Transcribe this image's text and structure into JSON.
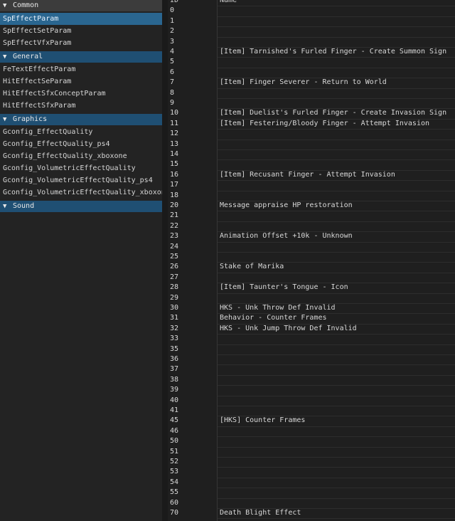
{
  "sidebar": {
    "categories": [
      {
        "label": "Common",
        "items": [
          "SpEffectParam",
          "SpEffectSetParam",
          "SpEffectVfxParam"
        ],
        "selected": 0
      },
      {
        "label": "General",
        "items": [
          "FeTextEffectParam",
          "HitEffectSeParam",
          "HitEffectSfxConceptParam",
          "HitEffectSfxParam"
        ]
      },
      {
        "label": "Graphics",
        "items": [
          "Gconfig_EffectQuality",
          "Gconfig_EffectQuality_ps4",
          "Gconfig_EffectQuality_xboxone",
          "Gconfig_VolumetricEffectQuality",
          "Gconfig_VolumetricEffectQuality_ps4",
          "Gconfig_VolumetricEffectQuality_xboxone"
        ]
      },
      {
        "label": "Sound",
        "items": []
      }
    ],
    "expand_icon": "triangle-down-icon"
  },
  "grid": {
    "header": {
      "id": "ID",
      "name": "Name"
    },
    "rows": [
      {
        "id": "0",
        "name": ""
      },
      {
        "id": "1",
        "name": ""
      },
      {
        "id": "2",
        "name": ""
      },
      {
        "id": "3",
        "name": ""
      },
      {
        "id": "4",
        "name": "[Item] Tarnished's Furled Finger - Create Summon Sign"
      },
      {
        "id": "5",
        "name": ""
      },
      {
        "id": "6",
        "name": ""
      },
      {
        "id": "7",
        "name": "[Item] Finger Severer - Return to World"
      },
      {
        "id": "8",
        "name": ""
      },
      {
        "id": "9",
        "name": ""
      },
      {
        "id": "10",
        "name": "[Item] Duelist's Furled Finger - Create Invasion Sign"
      },
      {
        "id": "11",
        "name": "[Item] Festering/Bloody Finger - Attempt Invasion"
      },
      {
        "id": "12",
        "name": ""
      },
      {
        "id": "13",
        "name": ""
      },
      {
        "id": "14",
        "name": ""
      },
      {
        "id": "15",
        "name": ""
      },
      {
        "id": "16",
        "name": "[Item] Recusant Finger - Attempt Invasion"
      },
      {
        "id": "17",
        "name": ""
      },
      {
        "id": "18",
        "name": ""
      },
      {
        "id": "20",
        "name": "Message appraise HP restoration"
      },
      {
        "id": "21",
        "name": ""
      },
      {
        "id": "22",
        "name": ""
      },
      {
        "id": "23",
        "name": "Animation Offset +10k - Unknown"
      },
      {
        "id": "24",
        "name": ""
      },
      {
        "id": "25",
        "name": ""
      },
      {
        "id": "26",
        "name": "Stake of Marika"
      },
      {
        "id": "27",
        "name": ""
      },
      {
        "id": "28",
        "name": "[Item] Taunter's Tongue - Icon"
      },
      {
        "id": "29",
        "name": ""
      },
      {
        "id": "30",
        "name": "HKS - Unk Throw Def Invalid"
      },
      {
        "id": "31",
        "name": "Behavior - Counter Frames"
      },
      {
        "id": "32",
        "name": "HKS - Unk Jump Throw Def Invalid"
      },
      {
        "id": "33",
        "name": ""
      },
      {
        "id": "35",
        "name": ""
      },
      {
        "id": "36",
        "name": ""
      },
      {
        "id": "37",
        "name": ""
      },
      {
        "id": "38",
        "name": ""
      },
      {
        "id": "39",
        "name": ""
      },
      {
        "id": "40",
        "name": ""
      },
      {
        "id": "41",
        "name": ""
      },
      {
        "id": "45",
        "name": "[HKS] Counter Frames"
      },
      {
        "id": "46",
        "name": ""
      },
      {
        "id": "50",
        "name": ""
      },
      {
        "id": "51",
        "name": ""
      },
      {
        "id": "52",
        "name": ""
      },
      {
        "id": "53",
        "name": ""
      },
      {
        "id": "54",
        "name": ""
      },
      {
        "id": "55",
        "name": ""
      },
      {
        "id": "60",
        "name": ""
      },
      {
        "id": "70",
        "name": "Death Blight Effect"
      }
    ]
  }
}
